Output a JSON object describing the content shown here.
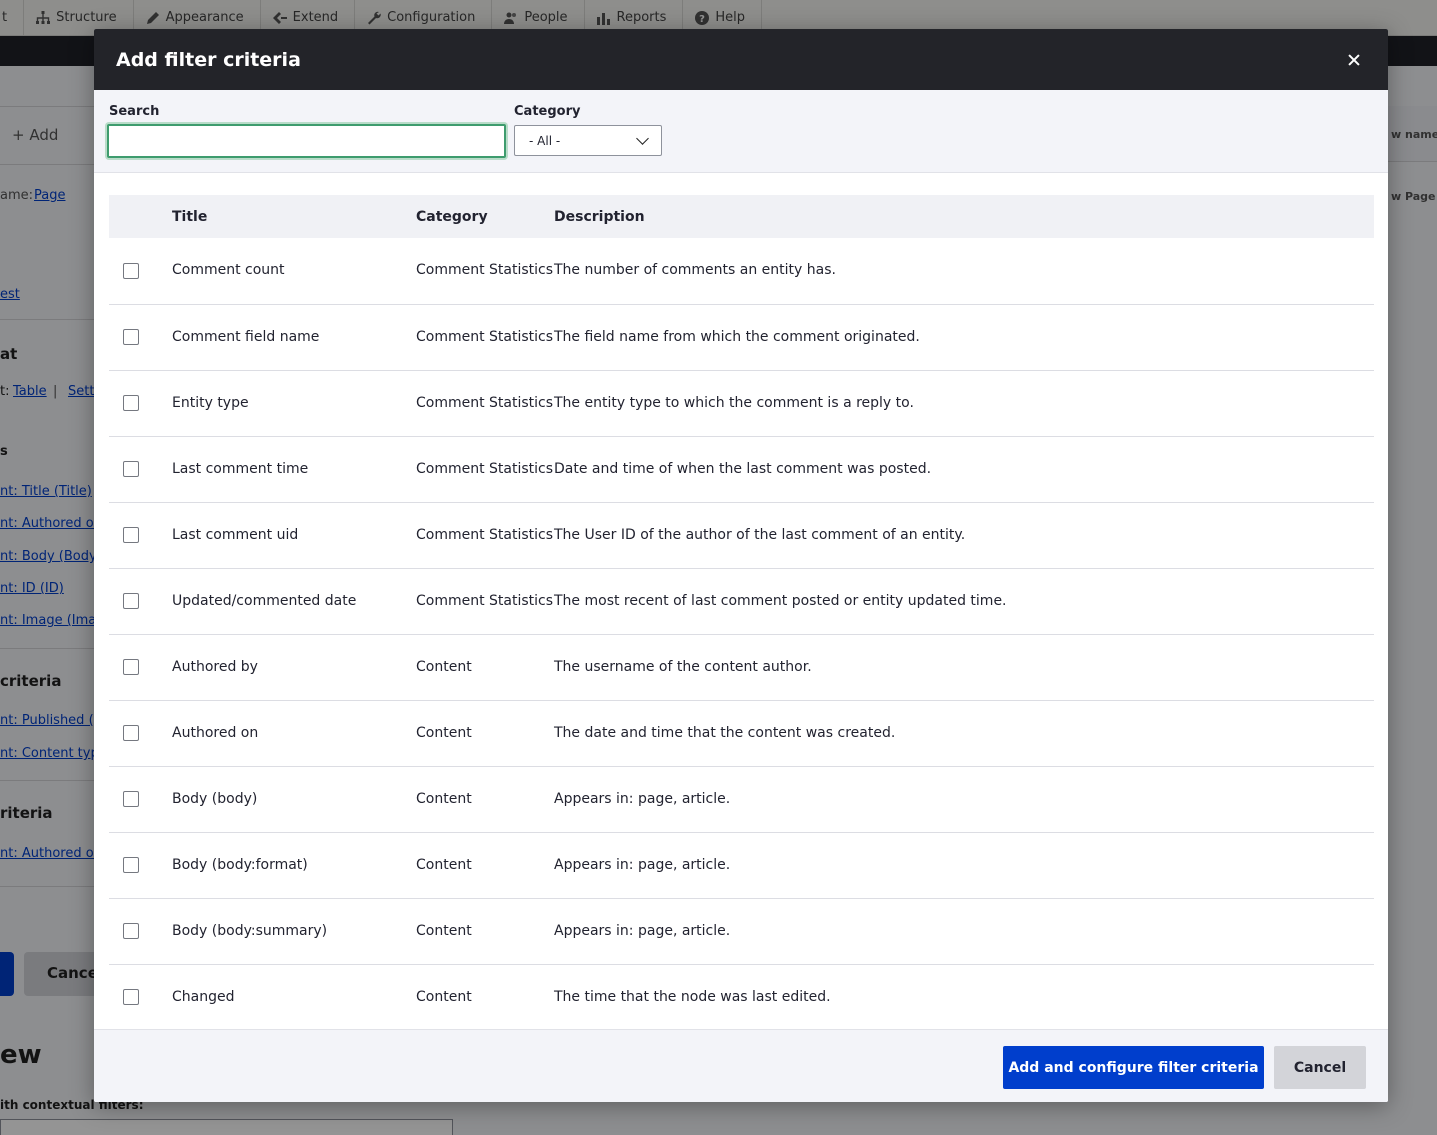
{
  "toolbar": {
    "items": [
      {
        "label": "t",
        "icon": "none"
      },
      {
        "label": "Structure",
        "icon": "structure-icon"
      },
      {
        "label": "Appearance",
        "icon": "appearance-icon"
      },
      {
        "label": "Extend",
        "icon": "extend-icon"
      },
      {
        "label": "Configuration",
        "icon": "wrench-icon"
      },
      {
        "label": "People",
        "icon": "people-icon"
      },
      {
        "label": "Reports",
        "icon": "reports-icon"
      },
      {
        "label": "Help",
        "icon": "help-icon"
      }
    ]
  },
  "background": {
    "add_label": "+ Add",
    "name_prefix": "ame:",
    "name_link": "Page",
    "link_est": "est",
    "heading_at": "at",
    "format_prefix": "t:",
    "format_link": "Table",
    "format_sep": "|",
    "format_link2": "Sett",
    "heading_s": "s",
    "fields": [
      "nt: Title (Title)",
      "nt: Authored on (",
      "nt: Body (Body)",
      "nt: ID (ID)",
      "nt: Image (Image"
    ],
    "heading_criteria": "criteria",
    "filters": [
      "nt: Published (= Y",
      "nt: Content type"
    ],
    "heading_criteria2": "riteria",
    "sorts": [
      "nt: Authored on ("
    ],
    "cancel_label": "Cancel",
    "preview_heading": "ew",
    "contextual_label": "ith contextual filters:",
    "right_label_1": "w name/d",
    "right_label_2": "w Page"
  },
  "dialog": {
    "title": "Add filter criteria",
    "search_label": "Search",
    "search_value": "",
    "category_label": "Category",
    "category_selected": "- All -",
    "table": {
      "headers": [
        "Title",
        "Category",
        "Description"
      ],
      "rows": [
        {
          "title": "Comment count",
          "category": "Comment Statistics",
          "description": "The number of comments an entity has."
        },
        {
          "title": "Comment field name",
          "category": "Comment Statistics",
          "description": "The field name from which the comment originated."
        },
        {
          "title": "Entity type",
          "category": "Comment Statistics",
          "description": "The entity type to which the comment is a reply to."
        },
        {
          "title": "Last comment time",
          "category": "Comment Statistics",
          "description": "Date and time of when the last comment was posted."
        },
        {
          "title": "Last comment uid",
          "category": "Comment Statistics",
          "description": "The User ID of the author of the last comment of an entity."
        },
        {
          "title": "Updated/commented date",
          "category": "Comment Statistics",
          "description": "The most recent of last comment posted or entity updated time."
        },
        {
          "title": "Authored by",
          "category": "Content",
          "description": "The username of the content author."
        },
        {
          "title": "Authored on",
          "category": "Content",
          "description": "The date and time that the content was created."
        },
        {
          "title": "Body (body)",
          "category": "Content",
          "description": "Appears in: page, article."
        },
        {
          "title": "Body (body:format)",
          "category": "Content",
          "description": "Appears in: page, article."
        },
        {
          "title": "Body (body:summary)",
          "category": "Content",
          "description": "Appears in: page, article."
        },
        {
          "title": "Changed",
          "category": "Content",
          "description": "The time that the node was last edited."
        }
      ]
    },
    "primary_button": "Add and configure filter criteria",
    "cancel_button": "Cancel"
  },
  "colors": {
    "primary": "#003ecc",
    "titlebar": "#232429",
    "focus_ring": "#3e9c6e"
  }
}
